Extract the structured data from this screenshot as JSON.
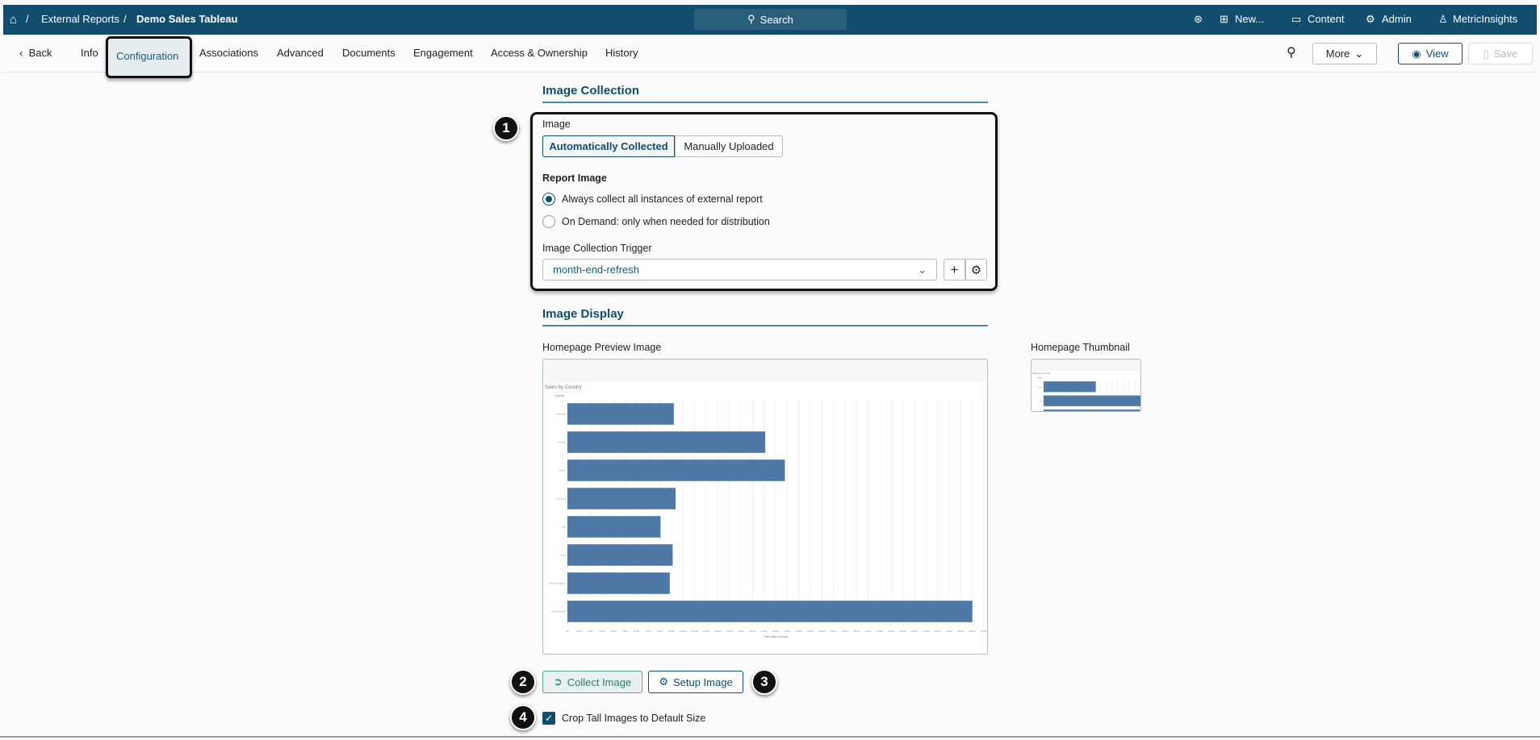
{
  "header": {
    "breadcrumb": [
      "External Reports",
      "Demo Sales Tableau"
    ],
    "search_label": "Search",
    "new_label": "New...",
    "content_label": "Content",
    "admin_label": "Admin",
    "user_label": "MetricInsights"
  },
  "nav": {
    "back": "Back",
    "tabs": [
      "Info",
      "Configuration",
      "Associations",
      "Advanced",
      "Documents",
      "Engagement",
      "Access & Ownership",
      "History"
    ],
    "active": "Configuration",
    "more": "More",
    "view": "View",
    "save": "Save"
  },
  "collection": {
    "title": "Image Collection",
    "image_label": "Image",
    "toggle": [
      "Automatically Collected",
      "Manually Uploaded"
    ],
    "toggle_selected": "Automatically Collected",
    "report_image_label": "Report Image",
    "radios": [
      "Always collect all instances of external report",
      "On Demand: only when needed for distribution"
    ],
    "radio_selected": 0,
    "trigger_label": "Image Collection Trigger",
    "trigger_value": "month-end-refresh"
  },
  "display": {
    "title": "Image Display",
    "preview_label": "Homepage Preview Image",
    "thumbnail_label": "Homepage Thumbnail"
  },
  "actions": {
    "collect": "Collect Image",
    "setup": "Setup Image",
    "crop_label": "Crop Tall Images to Default Size",
    "crop_checked": true
  },
  "badges": [
    "1",
    "2",
    "3",
    "4"
  ],
  "colors": {
    "brand": "#124d6d",
    "bar": "#4e79a7"
  },
  "chart_data": {
    "type": "bar",
    "orientation": "horizontal",
    "title": "Sales by Country",
    "ylabel": "Country",
    "xlabel": "Total Sales Amount",
    "categories": [
      "Australia",
      "Canada",
      "France",
      "Germany",
      "Italy",
      "Spain",
      "United Kingdom",
      "United States"
    ],
    "values": [
      920,
      1710,
      1880,
      935,
      805,
      910,
      885,
      3500
    ],
    "xlim": [
      0,
      3600
    ],
    "unit": "K"
  }
}
